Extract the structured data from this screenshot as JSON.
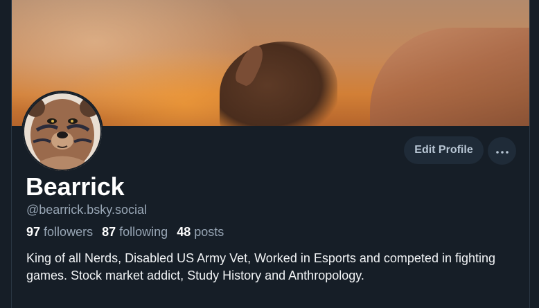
{
  "profile": {
    "display_name": "Bearrick",
    "handle": "@bearrick.bsky.social",
    "stats": {
      "followers_count": "97",
      "followers_label": "followers",
      "following_count": "87",
      "following_label": "following",
      "posts_count": "48",
      "posts_label": "posts"
    },
    "bio": "King of all Nerds, Disabled US Army Vet, Worked in Esports and competed in fighting games. Stock market addict, Study History and Anthropology."
  },
  "actions": {
    "edit_profile_label": "Edit Profile",
    "more_icon": "ellipsis-icon"
  },
  "colors": {
    "background": "#161e27",
    "button_bg": "#1f2b38",
    "muted_text": "#98a6b5",
    "primary_text": "#ffffff"
  }
}
